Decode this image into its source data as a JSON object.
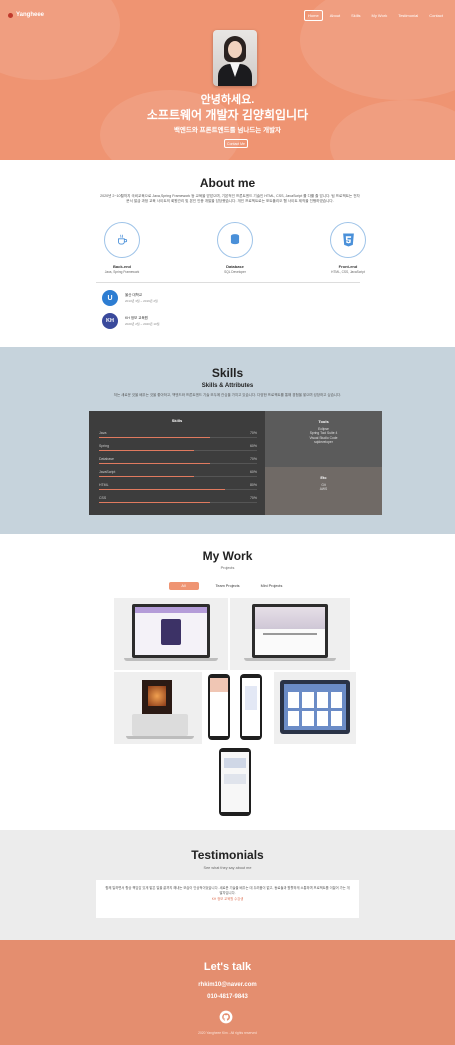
{
  "nav": {
    "brand": "Yangheee",
    "items": [
      "Home",
      "About",
      "Skills",
      "My Work",
      "Testimonial",
      "Contact"
    ]
  },
  "hero": {
    "greeting": "안녕하세요.",
    "title": "소프트웨어 개발자 김양희입니다",
    "subtitle": "백엔드와 프론트엔드를 넘나드는 개발자",
    "button": "Contact Me"
  },
  "about": {
    "title": "About me",
    "text": "2020년 2~10월까지 국비교육으로 Java,Spring Framework 등 교육을 받았으며, 기본적인 프론트엔드 기술인 HTML, CSS, JavaScript 를 다룰 줄 압니다. 팀 프로젝트는 전자문서 발급 과정 교육 사이트의 회원관리 및 본인 인증 개발을 담당했습니다. 개인 프로젝트로는 포트폴리오 웹 사이트 제작을 진행하였습니다.",
    "skills": [
      {
        "name": "Back-end",
        "desc": "Java, Spring Framework",
        "icon": "coffee-icon"
      },
      {
        "name": "Database",
        "desc": "SQL Developer",
        "icon": "database-icon"
      },
      {
        "name": "Front-end",
        "desc": "HTML, CSS, JavaScript",
        "icon": "html5-icon"
      }
    ],
    "education": [
      {
        "name": "울산 대학교",
        "date": "2013년 3월 ~ 2019년 2월",
        "logo": "U",
        "color": "#2d7dd2"
      },
      {
        "name": "KH 정보 교육원",
        "date": "2020년 2월 ~ 2020년 10월",
        "logo": "KH",
        "color": "#3a4a9c"
      }
    ]
  },
  "skills": {
    "title": "Skills",
    "subtitle": "Skills & Attributes",
    "text": "저는 새로운 것을 배우는 것을 좋아하고, 백엔드와 프론트엔드 기술 모두에 관심을 가지고 있습니다. 다양한 프로젝트를 통해 경험을 쌓으며 성장하고 싶습니다.",
    "panel_title": "Skills",
    "list": [
      {
        "name": "Java",
        "pct": "70%",
        "value": 70
      },
      {
        "name": "Spring",
        "pct": "60%",
        "value": 60
      },
      {
        "name": "Database",
        "pct": "70%",
        "value": 70
      },
      {
        "name": "JavaScript",
        "pct": "60%",
        "value": 60
      },
      {
        "name": "HTML",
        "pct": "80%",
        "value": 80
      },
      {
        "name": "CSS",
        "pct": "70%",
        "value": 70
      }
    ],
    "tools_title": "Tools",
    "tools": [
      "Eclipse",
      "Spring Tool Suite 4",
      "Visual Studio Code",
      "sqldeveloper"
    ],
    "etc_title": "Etc",
    "etc": [
      "Git",
      "AWS"
    ]
  },
  "work": {
    "title": "My Work",
    "subtitle": "Projects",
    "filters": [
      "All",
      "Team Projects",
      "Mini Projects"
    ],
    "accent": "#ef9472"
  },
  "testimonials": {
    "title": "Testimonials",
    "subtitle": "See what they say about me",
    "text": "함께 일하면서 항상 책임감 있게 맡은 일을 끝까지 해내는 모습이 인상적이었습니다. 새로운 기술을 배우는 데 두려움이 없고, 동료들과 원활하게 소통하며 프로젝트를 이끌어 가는 개발자입니다.",
    "author": "KH 정보 교육원 수강생"
  },
  "talk": {
    "title": "Let's talk",
    "email": "rhkim10@naver.com",
    "phone": "010-4817-9843",
    "copyright": "2020 Yangheee Kim - All rights reserved"
  }
}
